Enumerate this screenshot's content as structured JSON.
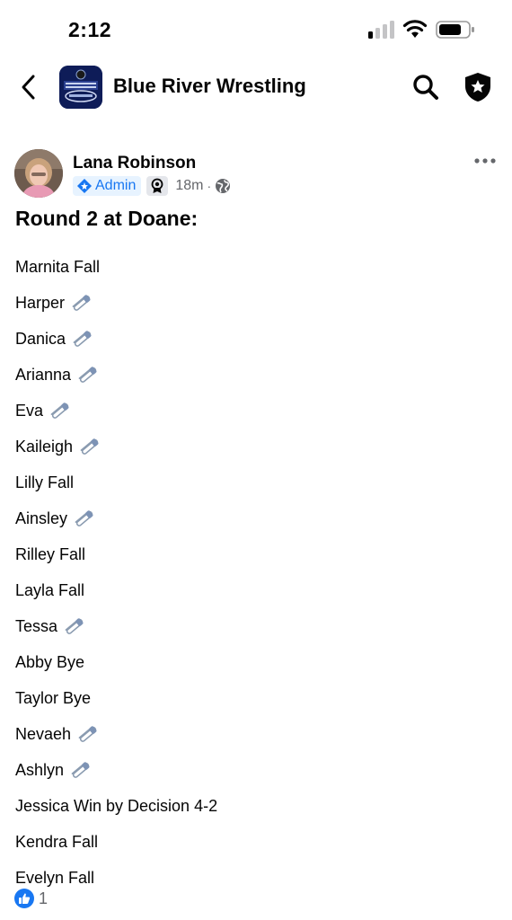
{
  "status_bar": {
    "time": "2:12"
  },
  "nav": {
    "group_name": "Blue River Wrestling"
  },
  "post": {
    "author": "Lana Robinson",
    "role_badge": "Admin",
    "time": "18m",
    "separator": "·",
    "title": "Round 2 at Doane:",
    "results": [
      {
        "name": "Marnita Fall",
        "pin": false
      },
      {
        "name": "Harper",
        "pin": true
      },
      {
        "name": "Danica",
        "pin": true
      },
      {
        "name": "Arianna",
        "pin": true
      },
      {
        "name": "Eva",
        "pin": true
      },
      {
        "name": "Kaileigh",
        "pin": true
      },
      {
        "name": "Lilly Fall",
        "pin": false
      },
      {
        "name": "Ainsley",
        "pin": true
      },
      {
        "name": "Rilley Fall",
        "pin": false
      },
      {
        "name": "Layla Fall",
        "pin": false
      },
      {
        "name": "Tessa",
        "pin": true
      },
      {
        "name": "Abby Bye",
        "pin": false
      },
      {
        "name": "Taylor Bye",
        "pin": false
      },
      {
        "name": "Nevaeh",
        "pin": true
      },
      {
        "name": "Ashlyn",
        "pin": true
      },
      {
        "name": "Jessica Win by Decision 4-2",
        "pin": false
      },
      {
        "name": "Kendra Fall",
        "pin": false
      },
      {
        "name": "Evelyn Fall",
        "pin": false
      }
    ],
    "reaction_count": "1"
  },
  "icons": {
    "back": "chevron-left-icon",
    "search": "search-icon",
    "admin": "shield-star-icon",
    "more": "more-horizontal-icon",
    "audience": "globe-icon",
    "pin": "safety-pin-icon",
    "like": "thumbs-up-icon"
  },
  "colors": {
    "accent": "#1877f2",
    "secondary_text": "#65676b",
    "admin_badge_bg": "#e7f3ff"
  }
}
